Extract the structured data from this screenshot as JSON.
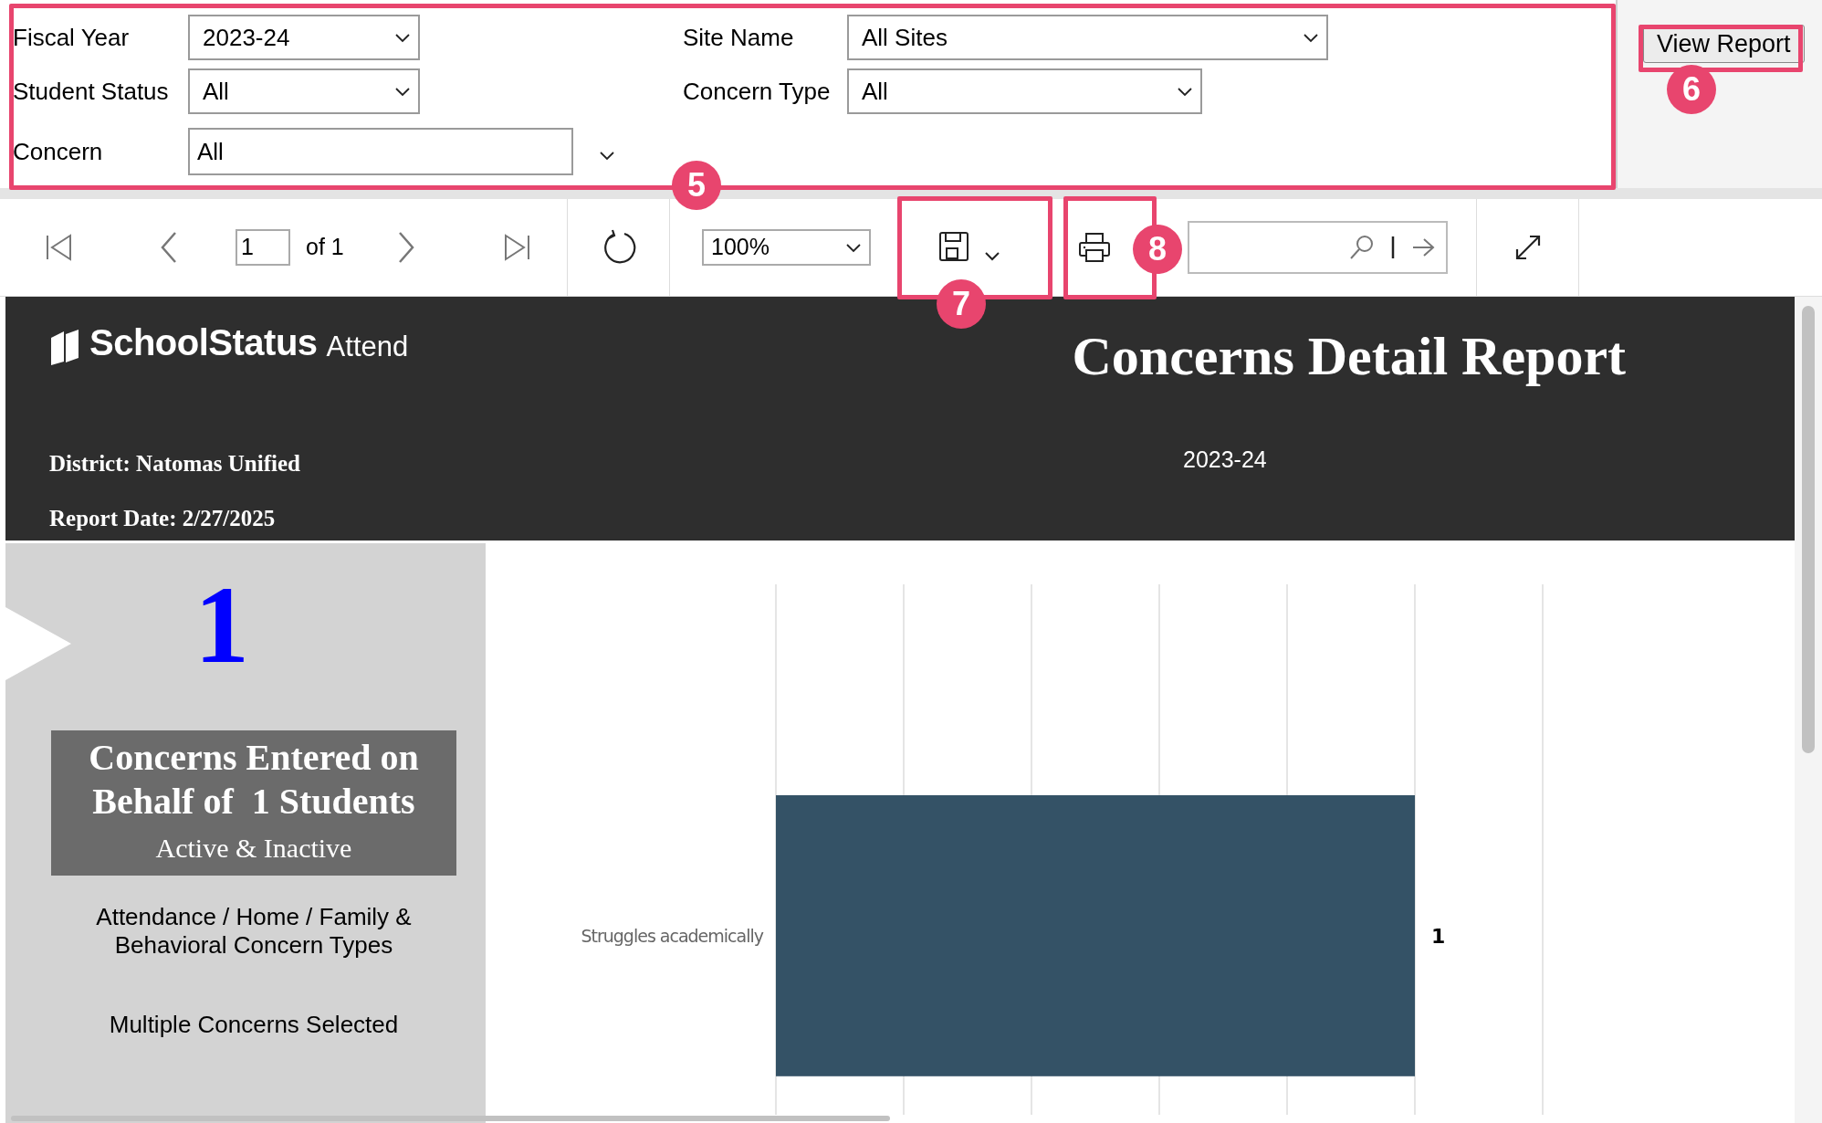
{
  "parameters": [
    {
      "label": "Fiscal Year",
      "value": "2023-24",
      "kind": "select"
    },
    {
      "label": "Student Status",
      "value": "All",
      "kind": "select"
    },
    {
      "label": "Concern",
      "value": "All",
      "kind": "multiselect"
    },
    {
      "label": "Site Name",
      "value": "All Sites",
      "kind": "select"
    },
    {
      "label": "Concern Type",
      "value": "All",
      "kind": "select"
    }
  ],
  "view_report_button": "View Report",
  "toolbar": {
    "page": "1",
    "page_count": "of 1",
    "zoom": "100%"
  },
  "report": {
    "logo": {
      "name": "SchoolStatus",
      "product": "Attend"
    },
    "title": "Concerns Detail Report",
    "district": "District: Natomas Unified",
    "report_date": "Report Date: 2/27/2025",
    "fiscal_year": "2023-24",
    "summary": {
      "count": "1",
      "heading": "Concerns Entered on Behalf of  1 Students",
      "subheading": "Active & Inactive",
      "concern_types": "Attendance / Home / Family & Behavioral Concern Types",
      "concern_note": "Multiple Concerns Selected"
    },
    "chart": {
      "bars": [
        {
          "label": "Struggles academically",
          "value_label": "1",
          "color": "#345266"
        }
      ]
    }
  },
  "callouts": [
    {
      "number": "5"
    },
    {
      "number": "6"
    },
    {
      "number": "7"
    },
    {
      "number": "8"
    }
  ]
}
